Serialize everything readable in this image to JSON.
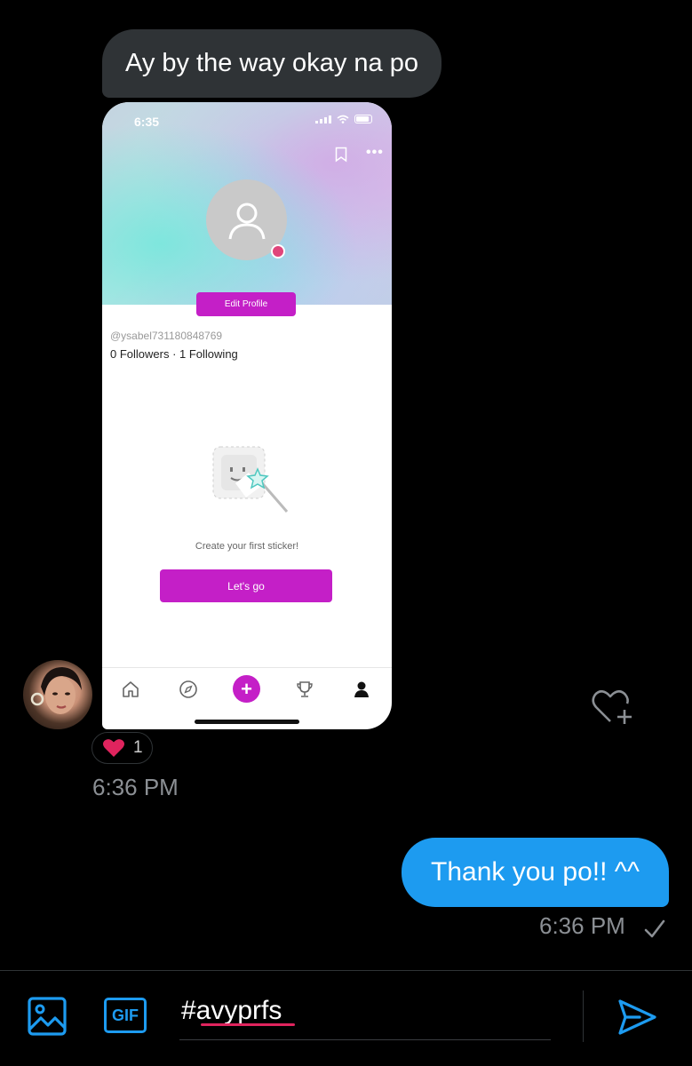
{
  "messages": {
    "incoming_text": "Ay by the way okay na po",
    "reaction_count": "1",
    "incoming_time": "6:36 PM",
    "outgoing_text": "Thank you po!! ^^",
    "outgoing_time": "6:36 PM"
  },
  "screenshot": {
    "status_time": "6:35",
    "edit_profile_label": "Edit Profile",
    "username": "@ysabel731180848769",
    "followers_line": "0 Followers · 1 Following",
    "empty_state_text": "Create your first sticker!",
    "cta_label": "Let's go",
    "accent_color": "#c41fc7"
  },
  "composer": {
    "gif_label": "GIF",
    "input_value": "#avyprfs"
  },
  "colors": {
    "background": "#000000",
    "incoming_bubble": "#2f3336",
    "outgoing_bubble": "#1d9bf0",
    "timestamp": "#8b8f94",
    "reaction_heart": "#e0245e"
  },
  "icons": {
    "media": "image-icon",
    "gif": "gif-icon",
    "send": "send-icon",
    "react": "heart-add-icon",
    "read_receipt": "check-icon"
  }
}
